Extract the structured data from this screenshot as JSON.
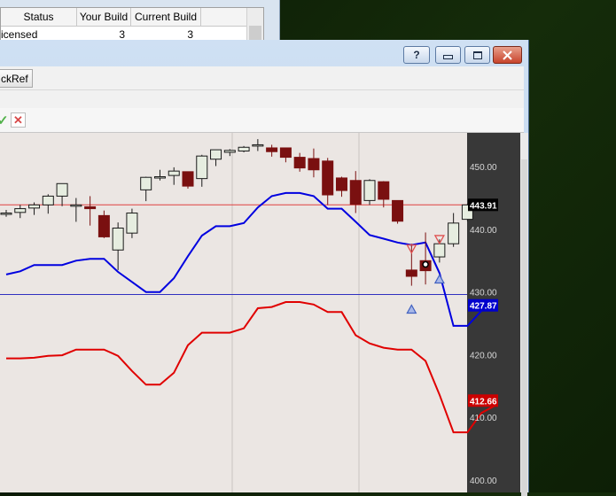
{
  "background_grid": {
    "columns": [
      "Status",
      "Your Build",
      "Current Build"
    ],
    "row": {
      "status": "icensed",
      "your_build": "3",
      "current_build": "3"
    }
  },
  "window": {
    "help_button": "?",
    "toolbar_tab": "ckRef"
  },
  "icons": {
    "accept": "check-icon",
    "cancel": "close-icon",
    "minimize": "minimize-icon",
    "maximize": "maximize-icon"
  },
  "colors": {
    "chart_bg": "#ebe6e3",
    "axis_bg": "#383838",
    "bull_candle": "#e6ede0",
    "bear_candle": "#7a1010",
    "upper_band": "#0000e0",
    "lower_band": "#e00000",
    "price_line": "#e04040",
    "level_line": "#3030c0"
  },
  "chart_data": {
    "type": "candlestick",
    "y_axis_ticks": [
      "450.00",
      "440.00",
      "430.00",
      "420.00",
      "410.00",
      "400.00"
    ],
    "ylim": [
      398,
      455.4
    ],
    "price_labels": [
      {
        "value": 443.91,
        "text": "443.91",
        "bg": "#000000"
      },
      {
        "value": 427.87,
        "text": "427.87",
        "bg": "#0000cc"
      },
      {
        "value": 412.66,
        "text": "412.66",
        "bg": "#cc0000"
      }
    ],
    "horizontal_lines": [
      {
        "value": 443.91,
        "color": "#e04040"
      },
      {
        "value": 429.6,
        "color": "#3030c0"
      }
    ],
    "candles": [
      {
        "o": 442.6,
        "h": 443.1,
        "l": 442.0,
        "c": 442.6
      },
      {
        "o": 442.7,
        "h": 443.9,
        "l": 441.8,
        "c": 443.3
      },
      {
        "o": 443.4,
        "h": 444.3,
        "l": 442.3,
        "c": 443.9
      },
      {
        "o": 443.9,
        "h": 445.6,
        "l": 442.5,
        "c": 445.3
      },
      {
        "o": 445.3,
        "h": 447.2,
        "l": 443.7,
        "c": 447.3
      },
      {
        "o": 443.9,
        "h": 445.0,
        "l": 441.2,
        "c": 443.9
      },
      {
        "o": 443.6,
        "h": 445.3,
        "l": 440.6,
        "c": 443.3
      },
      {
        "o": 442.2,
        "h": 443.0,
        "l": 438.6,
        "c": 438.8
      },
      {
        "o": 436.7,
        "h": 441.1,
        "l": 433.5,
        "c": 440.2
      },
      {
        "o": 439.4,
        "h": 443.3,
        "l": 438.6,
        "c": 442.6
      },
      {
        "o": 446.3,
        "h": 448.4,
        "l": 444.5,
        "c": 448.3
      },
      {
        "o": 448.3,
        "h": 449.5,
        "l": 447.8,
        "c": 448.4
      },
      {
        "o": 448.6,
        "h": 449.9,
        "l": 447.1,
        "c": 449.3
      },
      {
        "o": 449.2,
        "h": 449.2,
        "l": 446.5,
        "c": 446.9
      },
      {
        "o": 448.1,
        "h": 451.9,
        "l": 446.8,
        "c": 451.7
      },
      {
        "o": 451.2,
        "h": 452.6,
        "l": 450.1,
        "c": 452.7
      },
      {
        "o": 452.3,
        "h": 452.8,
        "l": 451.7,
        "c": 452.6
      },
      {
        "o": 452.5,
        "h": 453.3,
        "l": 452.3,
        "c": 453.1
      },
      {
        "o": 453.5,
        "h": 454.4,
        "l": 452.5,
        "c": 453.5
      },
      {
        "o": 453.0,
        "h": 453.5,
        "l": 451.6,
        "c": 452.4
      },
      {
        "o": 453.0,
        "h": 453.0,
        "l": 450.7,
        "c": 451.5
      },
      {
        "o": 451.5,
        "h": 452.2,
        "l": 449.2,
        "c": 449.8
      },
      {
        "o": 451.3,
        "h": 452.9,
        "l": 448.3,
        "c": 449.5
      },
      {
        "o": 450.9,
        "h": 451.4,
        "l": 443.9,
        "c": 445.5
      },
      {
        "o": 448.2,
        "h": 448.4,
        "l": 445.2,
        "c": 446.2
      },
      {
        "o": 447.8,
        "h": 449.3,
        "l": 442.6,
        "c": 444.0
      },
      {
        "o": 444.6,
        "h": 448.0,
        "l": 443.9,
        "c": 447.8
      },
      {
        "o": 447.6,
        "h": 447.7,
        "l": 443.5,
        "c": 444.8
      },
      {
        "o": 444.6,
        "h": 444.6,
        "l": 440.9,
        "c": 441.3
      },
      {
        "o": 433.5,
        "h": 437.7,
        "l": 431.0,
        "c": 432.5
      },
      {
        "o": 435.0,
        "h": 439.5,
        "l": 431.2,
        "c": 433.4
      },
      {
        "o": 435.6,
        "h": 438.4,
        "l": 434.7,
        "c": 437.7
      },
      {
        "o": 437.7,
        "h": 442.6,
        "l": 437.2,
        "c": 441.0
      },
      {
        "o": 441.6,
        "h": 444.1,
        "l": 441.3,
        "c": 443.9
      }
    ],
    "series": [
      {
        "values": [
          432.8,
          433.3,
          434.3,
          434.3,
          434.3,
          435.0,
          435.3,
          435.3,
          433.2,
          431.6,
          430.0,
          430.0,
          432.2,
          435.7,
          439.0,
          440.5,
          440.5,
          441.0,
          443.5,
          445.3,
          445.8,
          445.8,
          445.3,
          443.3,
          443.3,
          441.2,
          439.1,
          438.5,
          437.9,
          437.5,
          437.9,
          433.0,
          424.6,
          424.6,
          427.0
        ]
      },
      {
        "values": [
          419.4,
          419.4,
          419.5,
          419.8,
          419.9,
          420.8,
          420.8,
          420.8,
          419.8,
          417.4,
          415.2,
          415.2,
          417.1,
          421.5,
          423.5,
          423.5,
          423.5,
          424.2,
          427.4,
          427.6,
          428.4,
          428.4,
          428.0,
          426.8,
          426.8,
          423.1,
          421.8,
          421.1,
          420.8,
          420.8,
          419.0,
          413.6,
          407.6,
          407.6,
          410.7,
          411.9
        ]
      }
    ],
    "markers": [
      {
        "idx": 29,
        "value": 436.8,
        "shape": "triangle-down",
        "color": "#e05050"
      },
      {
        "idx": 29,
        "value": 427.2,
        "shape": "triangle-up",
        "color": "#4060c0"
      },
      {
        "idx": 30,
        "value": 434.4,
        "shape": "circle-dot",
        "color": "#000000"
      },
      {
        "idx": 31,
        "value": 438.3,
        "shape": "triangle-down",
        "color": "#e05050"
      },
      {
        "idx": 31,
        "value": 432.0,
        "shape": "triangle-up",
        "color": "#4060c0"
      }
    ]
  }
}
